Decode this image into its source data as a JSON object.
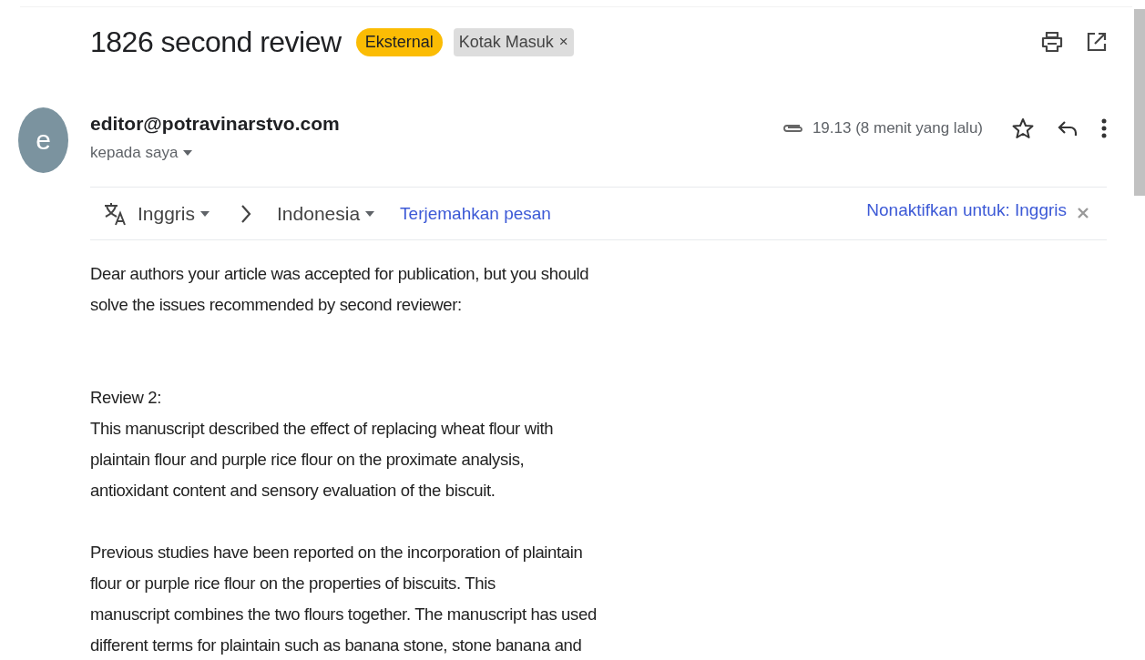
{
  "subject": "1826 second review",
  "labels": [
    {
      "text": "Eksternal",
      "kind": "badge"
    },
    {
      "text": "Kotak Masuk",
      "kind": "tag",
      "remove": "×"
    }
  ],
  "sender": {
    "avatar": "e",
    "email": "editor@potravinarstvo.com",
    "to": "kepada saya",
    "time": "19.13 (8 menit yang lalu)",
    "has_attachment": true,
    "starred": false
  },
  "translate": {
    "from": "Inggris",
    "to": "Indonesia",
    "action": "Terjemahkan pesan",
    "disable": "Nonaktifkan untuk: Inggris"
  },
  "body": [
    {
      "lines": [
        "Dear authors your article was accepted for publication, but you should",
        "solve the issues recommended by second reviewer:"
      ]
    },
    {
      "lines": [
        "Review 2:",
        "This manuscript described the effect of replacing wheat flour with",
        "plaintain flour and purple rice flour on the proximate analysis,",
        "antioxidant content and sensory evaluation of the biscuit."
      ]
    },
    {
      "lines": [
        "Previous studies have been reported on the incorporation of plaintain",
        "flour or purple rice flour on the properties of biscuits. This",
        "manuscript combines the two flours together. The manuscript has used",
        "different  terms for plaintain such as banana stone, stone banana and"
      ]
    }
  ]
}
